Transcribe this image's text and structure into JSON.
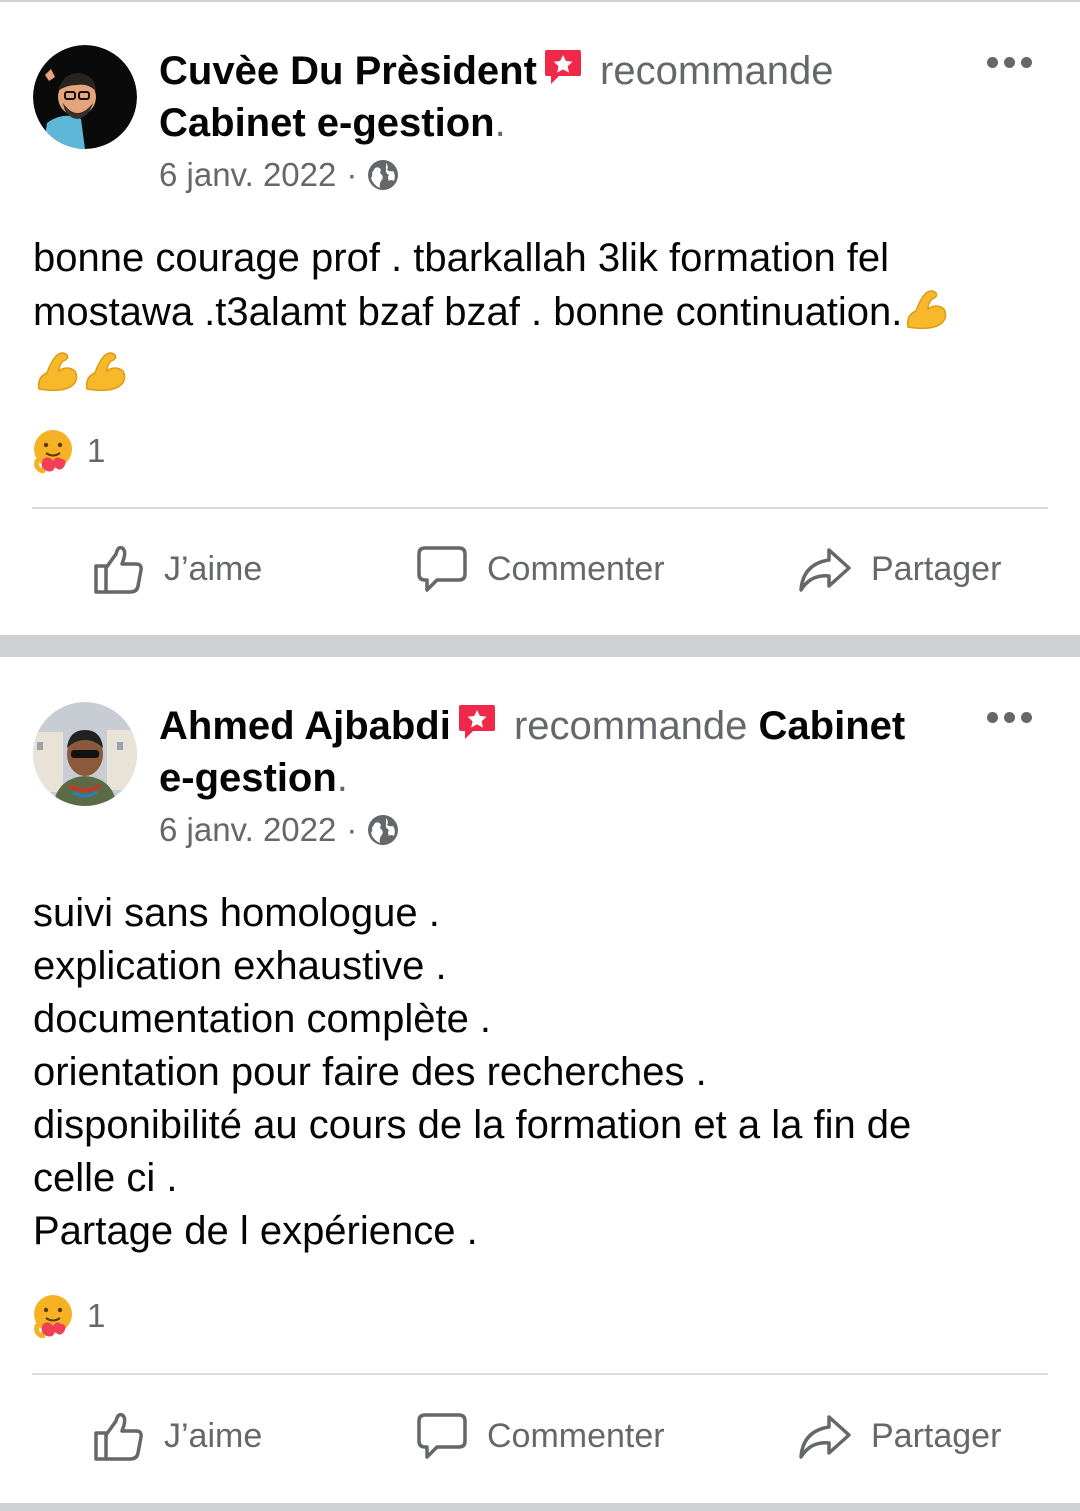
{
  "posts": [
    {
      "author": "Cuvèe Du Prèsident",
      "recommends_word": "recommande",
      "page_name": "Cabinet e-gestion",
      "trailing_dot": ".",
      "date": "6 janv. 2022",
      "separator": "·",
      "body_lines": [
        "bonne courage prof . tbarkallah 3lik formation fel",
        "mostawa .t3alamt bzaf bzaf . bonne continuation."
      ],
      "reaction_count": "1",
      "icons": {
        "reaction": "care-reaction-icon",
        "privacy": "globe-icon",
        "badge": "recommend-badge-icon",
        "menu": "more-options-icon"
      }
    },
    {
      "author": "Ahmed Ajbabdi",
      "recommends_word": "recommande",
      "page_name_part1": "Cabinet",
      "page_name_part2": "e-gestion",
      "trailing_dot": ".",
      "date": "6 janv. 2022",
      "separator": "·",
      "body_lines": [
        "suivi sans homologue .",
        "explication exhaustive .",
        "documentation complète .",
        "orientation pour faire des recherches .",
        "disponibilité au cours de la formation et a la fin de",
        "celle ci .",
        "Partage de l expérience ."
      ],
      "reaction_count": "1"
    }
  ],
  "actions": {
    "like": "J’aime",
    "comment": "Commenter",
    "share": "Partager"
  },
  "colors": {
    "text_primary": "#050505",
    "text_secondary": "#65676b",
    "separator": "#ced0d4",
    "badge": "#f02849",
    "muscle_emoji": "#f7b92b"
  }
}
